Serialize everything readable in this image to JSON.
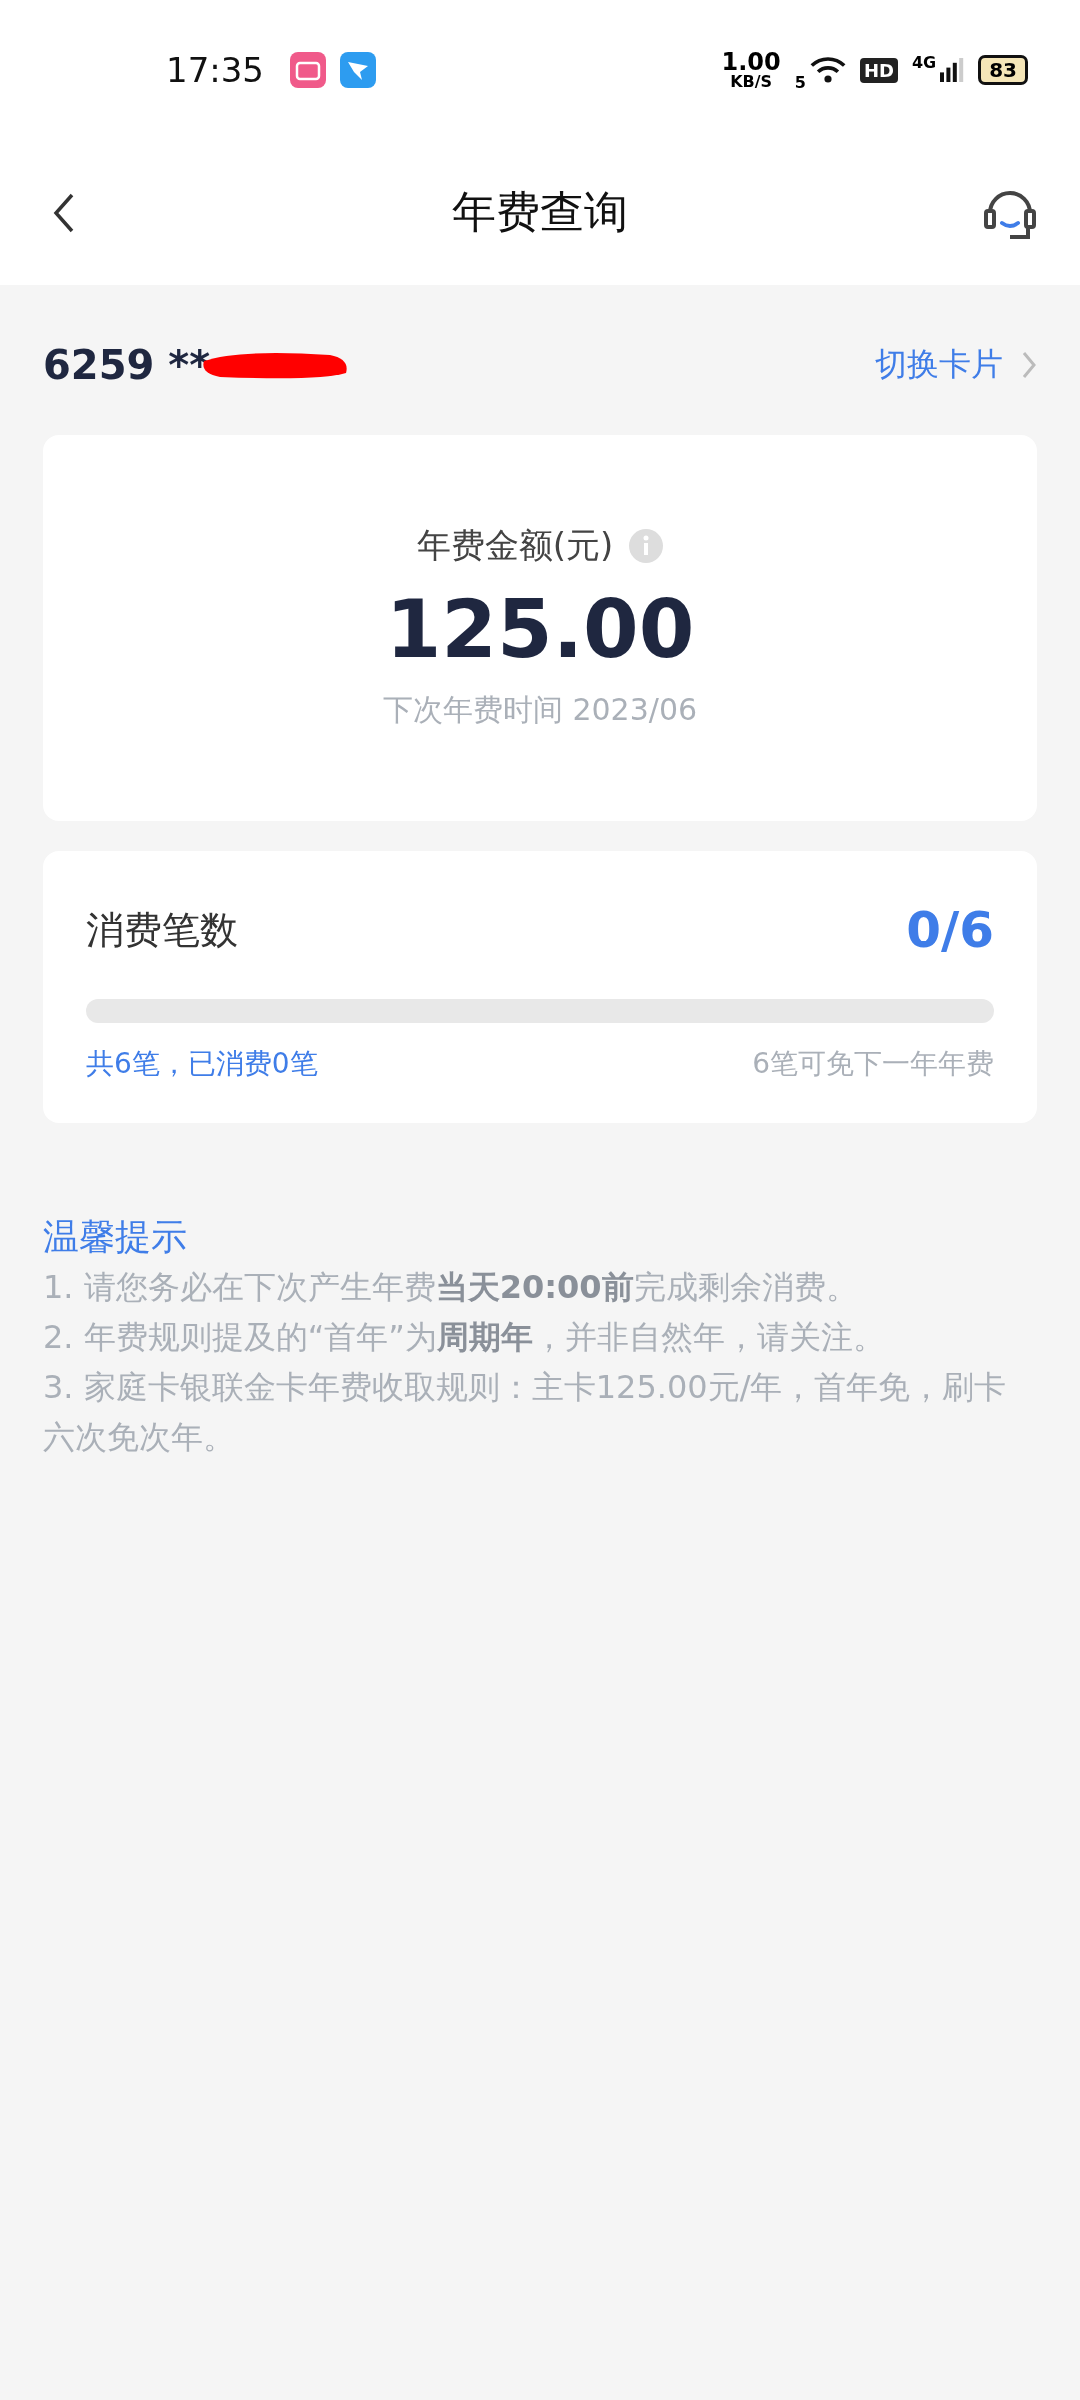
{
  "status_bar": {
    "time": "17:35",
    "net_speed": "1.00",
    "net_unit": "KB/S",
    "wifi_band": "5",
    "hd": "HD",
    "network": "4G",
    "battery": "83"
  },
  "nav": {
    "title": "年费查询"
  },
  "card": {
    "number": "6259 **",
    "switch_label": "切换卡片"
  },
  "fee": {
    "label": "年费金额(元)",
    "amount": "125.00",
    "next_date": "下次年费时间 2023/06"
  },
  "count": {
    "title": "消费笔数",
    "value": "0/6",
    "level": 0,
    "summary": "共6笔，已消费0笔",
    "hint": "6笔可免下一年年费"
  },
  "tips": {
    "title": "温馨提示",
    "items": [
      "1. 请您务必在下次产生年费**当天20:00前**完成剩余消费。",
      "2. 年费规则提及的“首年”为**周期年**，并非自然年，请关注。",
      "3. 家庭卡银联金卡年费收取规则：主卡125.00元/年，首年免，刷卡六次免次年。"
    ]
  }
}
